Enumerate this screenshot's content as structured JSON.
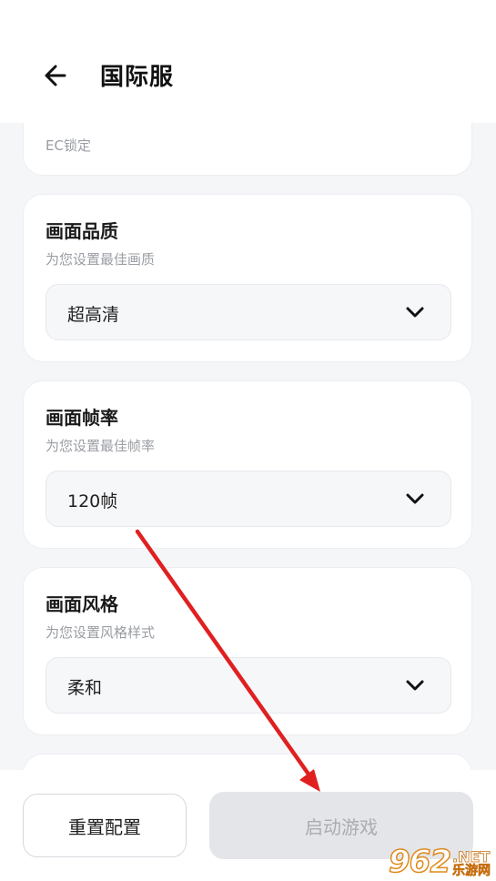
{
  "header": {
    "title": "国际服",
    "back_icon": "arrow-left-icon"
  },
  "cards": {
    "ec_lock": {
      "desc": "EC锁定"
    },
    "quality": {
      "title": "画面品质",
      "desc": "为您设置最佳画质",
      "selected": "超高清"
    },
    "fps": {
      "title": "画面帧率",
      "desc": "为您设置最佳帧率",
      "selected": "120帧"
    },
    "style": {
      "title": "画面风格",
      "desc": "为您设置风格样式",
      "selected": "柔和"
    }
  },
  "footer": {
    "reset_label": "重置配置",
    "start_label": "启动游戏"
  },
  "watermark": {
    "digits": "962",
    "suffix": ".NET",
    "cn": "乐游网"
  },
  "colors": {
    "annotation_arrow": "#e02020",
    "start_button_bg": "#e3e5e8",
    "start_button_text": "#a9acb1"
  }
}
